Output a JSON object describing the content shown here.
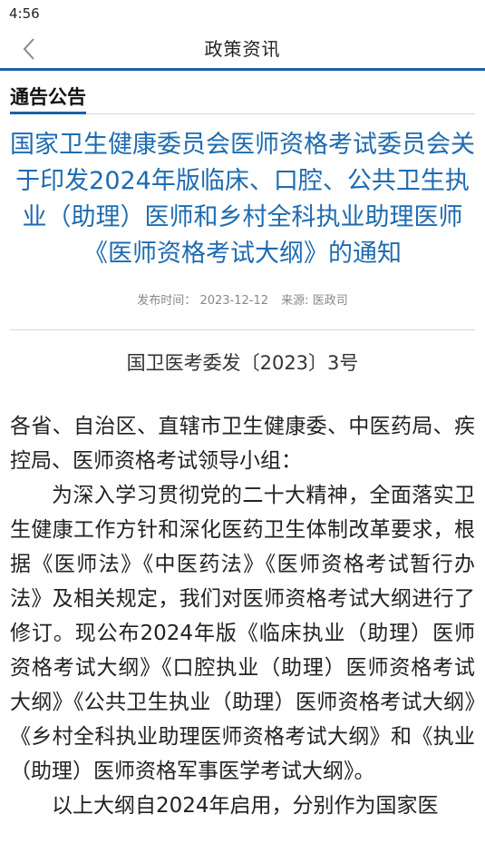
{
  "status_bar": {
    "time": "4:56"
  },
  "nav": {
    "title": "政策资讯"
  },
  "category": {
    "label": "通告公告"
  },
  "article": {
    "title": "国家卫生健康委员会医师资格考试委员会关于印发2024年版临床、口腔、公共卫生执业（助理）医师和乡村全科执业助理医师《医师资格考试大纲》的通知",
    "publish_label": "发布时间：",
    "publish_date": "2023-12-12",
    "source_label": "来源:",
    "source": "医政司",
    "doc_number": "国卫医考委发〔2023〕3号",
    "paragraphs": [
      "各省、自治区、直辖市卫生健康委、中医药局、疾控局、医师资格考试领导小组：",
      "为深入学习贯彻党的二十大精神，全面落实卫生健康工作方针和深化医药卫生体制改革要求，根据《医师法》《中医药法》《医师资格考试暂行办法》及相关规定，我们对医师资格考试大纲进行了修订。现公布2024年版《临床执业（助理）医师资格考试大纲》《口腔执业（助理）医师资格考试大纲》《公共卫生执业（助理）医师资格考试大纲》《乡村全科执业助理医师资格考试大纲》和《执业（助理）医师资格军事医学考试大纲》。",
      "以上大纲自2024年启用，分别作为国家医"
    ]
  },
  "colors": {
    "accent": "#1b5fa4",
    "title": "#1e6bb0",
    "meta": "#888888"
  },
  "icons": {
    "back": "chevron-left-icon"
  }
}
